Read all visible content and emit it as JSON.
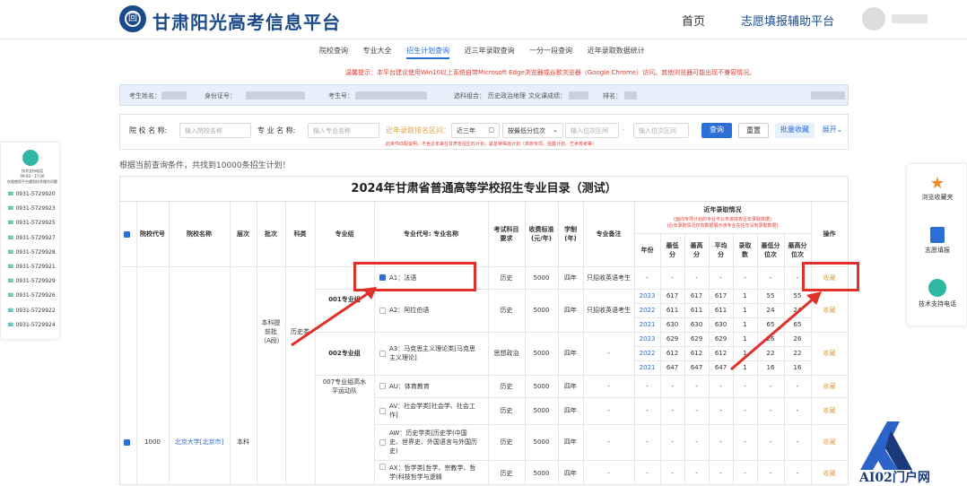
{
  "header": {
    "brand": "甘肃阳光高考信息平台",
    "logo_glyph": "回",
    "nav_home": "首页",
    "nav_aux": "志愿填报辅助平台"
  },
  "tabs": [
    "院校查询",
    "专业大全",
    "招生计划查询",
    "近三年录取查询",
    "一分一段查询",
    "近年录取数据统计"
  ],
  "active_tab": "招生计划查询",
  "notice": "温馨提示：本平台建议使用Win10以上系统自带Microsoft Edge浏览器或谷歌浏览器（Google Chrome）访问。其他浏览器可能出现不兼容情况。",
  "student_info": {
    "name_label": "考生姓名：",
    "id_label": "身份证号：",
    "exam_no_label": "考生号：",
    "subject_label": "选科组合：",
    "subject_value": "历史政治地理",
    "culture_label": "文化课成绩：",
    "rank_label": "排名："
  },
  "filters": {
    "school_label": "院 校 名 称:",
    "school_placeholder": "输入院校名称",
    "major_label": "专 业 名 称:",
    "major_placeholder": "输入专业名称",
    "range_label": "近年录取排名区间：",
    "year_select": "近三年",
    "sort_select": "按最低分位次",
    "from_placeholder": "输入位次区间",
    "to_placeholder": "输入位次区间",
    "query": "查询",
    "reset": "重置",
    "batch_fav": "批量收藏",
    "expand": "展开",
    "hint": "此条件匹配说明，不含近年来在甘肃省招生的计划，紧急特殊批计划（高校专项、强基计划、艺术校考等）"
  },
  "result_text": "根据当前查询条件，共找到10000条招生计划！",
  "left_sidebar": {
    "title": "技术支持电话",
    "time": "09:00 - 17:00",
    "note": "仅限使用平台遇到技术操作问题",
    "phones": [
      "0931-5729920",
      "0931-5729923",
      "0931-5729925",
      "0931-5729927",
      "0931-5729928",
      "0931-5729921",
      "0931-5729929",
      "0931-5729926",
      "0931-5729922",
      "0931-5729924"
    ]
  },
  "right_sidebar": {
    "items": [
      {
        "label": "浏览收藏夹",
        "icon": "star-icon"
      },
      {
        "label": "志愿填报",
        "icon": "form-icon"
      },
      {
        "label": "技术支持电话",
        "icon": "headset-icon"
      }
    ]
  },
  "table": {
    "title": "2024年甘肃省普通高等学校招生专业目录（测试）",
    "headers": {
      "school_code": "院校代号",
      "school_name": "院校名称",
      "level": "层次",
      "batch": "批次",
      "category": "科类",
      "group": "专业组",
      "major": "专业代号: 专业名称",
      "req": "考试科目要求",
      "fee": "收费标准(元/年)",
      "years": "学制(年)",
      "remark": "专业备注",
      "recent": "近年录取情况",
      "recent_note1": "(面向专项计划的专业不公布该院校近年录取数据)",
      "recent_note2": "(近年录取情况仅有数据展示该专业在往年没有录取数据)",
      "year": "年份",
      "min": "最低分",
      "max": "最高分",
      "avg": "平均分",
      "count": "录取数",
      "min_rank": "最低分位次",
      "max_rank": "最高分位次",
      "op": "操作"
    },
    "school": {
      "code": "1000",
      "name": "北京大学[北京市]",
      "level": "本科"
    },
    "batch_text": "本科提前批（A段）",
    "category_text": "历史类",
    "groups": [
      "001专业组",
      "002专业组",
      "007专业组高水平运动队"
    ],
    "rows": [
      {
        "major": "A1：法语",
        "req": "历史",
        "fee": "5000",
        "years": "四年",
        "remark": "只招收英语考生",
        "op": "收藏",
        "stats": []
      },
      {
        "major": "A2：阿拉伯语",
        "req": "历史",
        "fee": "5000",
        "years": "四年",
        "remark": "只招收英语考生",
        "op": "收藏",
        "stats": [
          [
            "2023",
            "617",
            "617",
            "617",
            "1",
            "55",
            "55"
          ],
          [
            "2022",
            "611",
            "611",
            "611",
            "1",
            "24",
            "24"
          ],
          [
            "2021",
            "630",
            "630",
            "630",
            "1",
            "65",
            "65"
          ]
        ]
      },
      {
        "major": "A3：马克思主义理论类[马克思主义理论]",
        "req": "思想政治",
        "fee": "5000",
        "years": "四年",
        "remark": "-",
        "op": "收藏",
        "stats": [
          [
            "2023",
            "629",
            "629",
            "629",
            "1",
            "26",
            "26"
          ],
          [
            "2022",
            "612",
            "612",
            "612",
            "1",
            "22",
            "22"
          ],
          [
            "2021",
            "647",
            "647",
            "647",
            "1",
            "16",
            "16"
          ]
        ]
      },
      {
        "major": "AU：体育教育",
        "req": "历史",
        "fee": "5000",
        "years": "四年",
        "remark": "-",
        "op": "收藏",
        "stats": []
      },
      {
        "major": "AV：社会学类[社会学、社会工作]",
        "req": "历史",
        "fee": "5000",
        "years": "四年",
        "remark": "-",
        "op": "收藏",
        "stats": []
      },
      {
        "major": "AW：历史学类[历史学(中国史、世界史、外国语言与外国历史)",
        "req": "历史",
        "fee": "5000",
        "years": "四年",
        "remark": "-",
        "op": "收藏",
        "stats": []
      },
      {
        "major": "AX：哲学类[哲学、宗教学、哲学(科技哲学与逻辑",
        "req": "历史",
        "fee": "5000",
        "years": "四年",
        "remark": "-",
        "op": "收藏",
        "stats": []
      }
    ],
    "dash": "-"
  },
  "watermark": "AI02门户网"
}
